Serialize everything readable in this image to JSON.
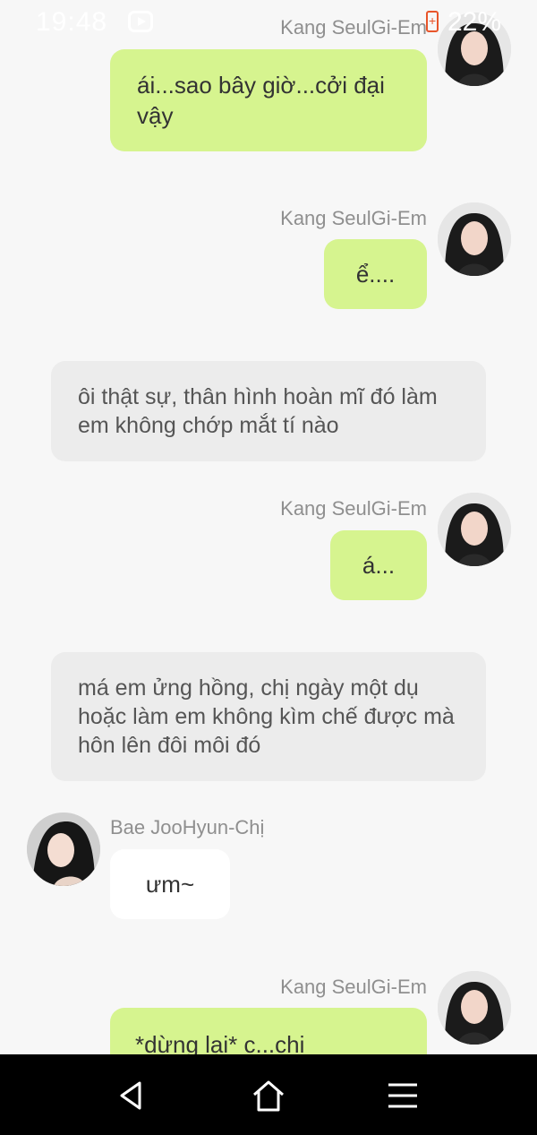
{
  "status": {
    "time": "19:48",
    "battery": "22%",
    "app_icon": "youtube-icon",
    "battery_icon": "battery-charging-icon"
  },
  "colors": {
    "background": "#f7f7f7",
    "bubble_green": "#d6f48f",
    "bubble_white": "#ffffff",
    "narration_bg": "#ececec",
    "name_text": "#8f8f8f",
    "navbar": "#000000"
  },
  "messages": [
    {
      "type": "sent",
      "sender": "Kang SeulGi-Em",
      "text": "ái...sao bây giờ...cởi đại vậy"
    },
    {
      "type": "sent",
      "sender": "Kang SeulGi-Em",
      "text": "ể...."
    },
    {
      "type": "narration",
      "text": "ôi thật sự, thân hình hoàn mĩ đó làm em không chớp mắt tí nào"
    },
    {
      "type": "sent",
      "sender": "Kang SeulGi-Em",
      "text": "á..."
    },
    {
      "type": "narration",
      "text": "má em ửng hồng, chị ngày một dụ hoặc làm em không kìm chế được mà hôn lên đôi môi đó"
    },
    {
      "type": "received",
      "sender": "Bae JooHyun-Chị",
      "text": "ưm~"
    },
    {
      "type": "sent",
      "sender": "Kang SeulGi-Em",
      "text": "*dừng lại* c...chi"
    }
  ],
  "navbar": {
    "icons": [
      "back-icon",
      "home-icon",
      "menu-icon"
    ]
  }
}
